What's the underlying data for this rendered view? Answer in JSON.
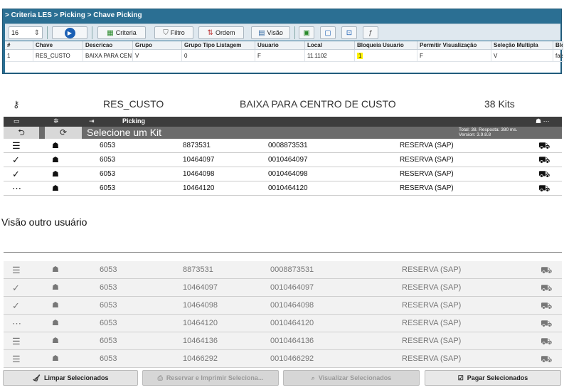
{
  "panel1": {
    "breadcrumb": "> Criteria LES > Picking > Chave Picking",
    "page_size": "16",
    "toolbar": {
      "criteria": "Criteria",
      "filtro": "Filtro",
      "ordem": "Ordem",
      "visao": "Visão"
    },
    "columns": [
      "#",
      "Chave",
      "Descricao",
      "Grupo",
      "Grupo Tipo Listagem",
      "Usuario",
      "Local",
      "Bloqueia Usuario",
      "Permitir Visualização",
      "Seleção Multipla",
      "Blo"
    ],
    "row": [
      "1",
      "RES_CUSTO",
      "BAIXA PARA CEN",
      "V",
      "0",
      "F",
      "11.1102",
      "1",
      "F",
      "V",
      "fals"
    ]
  },
  "panel2": {
    "header": {
      "key": "RES_CUSTO",
      "description": "BAIXA PARA CENTRO DE CUSTO",
      "count": "38 Kits"
    },
    "menu_label": "Picking",
    "title": "Selecione um Kit",
    "total": "Total: 38. Resposta: 380 ms.",
    "version": "Version: 3.9.8.8",
    "rows": [
      {
        "icon": "list",
        "c1": "6053",
        "c2": "8873531",
        "c3": "0008873531",
        "c4": "RESERVA (SAP)"
      },
      {
        "icon": "check",
        "c1": "6053",
        "c2": "10464097",
        "c3": "0010464097",
        "c4": "RESERVA (SAP)"
      },
      {
        "icon": "check",
        "c1": "6053",
        "c2": "10464098",
        "c3": "0010464098",
        "c4": "RESERVA (SAP)"
      },
      {
        "icon": "dots",
        "c1": "6053",
        "c2": "10464120",
        "c3": "0010464120",
        "c4": "RESERVA (SAP)"
      }
    ]
  },
  "caption": "Visão outro usuário",
  "panel3": {
    "rows": [
      {
        "icon": "list",
        "c1": "6053",
        "c2": "8873531",
        "c3": "0008873531",
        "c4": "RESERVA (SAP)"
      },
      {
        "icon": "check",
        "c1": "6053",
        "c2": "10464097",
        "c3": "0010464097",
        "c4": "RESERVA (SAP)"
      },
      {
        "icon": "check",
        "c1": "6053",
        "c2": "10464098",
        "c3": "0010464098",
        "c4": "RESERVA (SAP)"
      },
      {
        "icon": "dots",
        "c1": "6053",
        "c2": "10464120",
        "c3": "0010464120",
        "c4": "RESERVA (SAP)"
      },
      {
        "icon": "list",
        "c1": "6053",
        "c2": "10464136",
        "c3": "0010464136",
        "c4": "RESERVA (SAP)"
      },
      {
        "icon": "list",
        "c1": "6053",
        "c2": "10466292",
        "c3": "0010466292",
        "c4": "RESERVA (SAP)"
      }
    ],
    "buttons": {
      "limpar": "Limpar Selecionados",
      "reservar": "Reservar e Imprimir Seleciona...",
      "visualizar": "Visualizar Selecionados",
      "pagar": "Pagar Selecionados"
    }
  }
}
